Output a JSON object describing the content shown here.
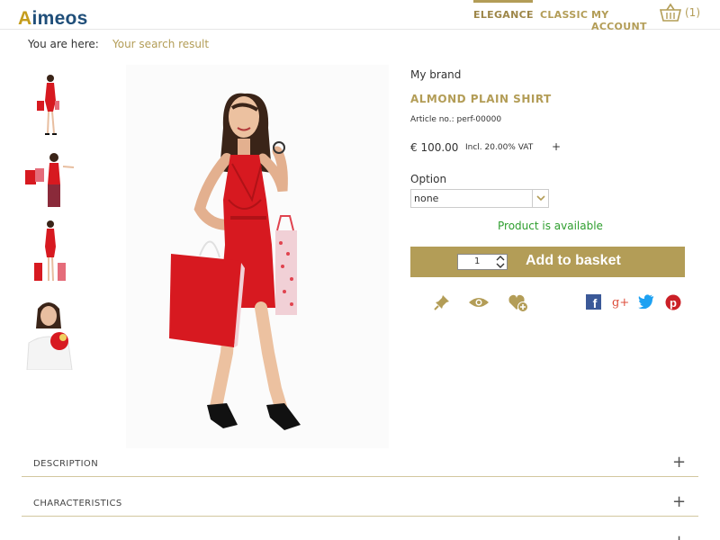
{
  "logo": {
    "first": "A",
    "rest": "imeos"
  },
  "nav": {
    "elegance": "ELEGANCE",
    "classic": "CLASSIC",
    "my_account": "MY ACCOUNT"
  },
  "basket": {
    "icon": "basket-icon",
    "count": "(1)"
  },
  "breadcrumb": {
    "label": "You are here:",
    "current": "Your search result"
  },
  "product": {
    "brand": "My brand",
    "title": "ALMOND PLAIN SHIRT",
    "article": "Article no.: perf-00000",
    "price": "€ 100.00",
    "vat": "Incl. 20.00% VAT",
    "price_more": "+",
    "option_label": "Option",
    "option_value": "none",
    "availability": "Product is available",
    "quantity": "1",
    "add_button": "Add to basket"
  },
  "actions": [
    {
      "name": "pin-icon"
    },
    {
      "name": "eye-icon"
    },
    {
      "name": "heart-plus-icon"
    }
  ],
  "share": [
    {
      "name": "facebook-icon",
      "label": "f"
    },
    {
      "name": "google-plus-icon",
      "label": "g+"
    },
    {
      "name": "twitter-icon"
    },
    {
      "name": "pinterest-icon",
      "label": "p"
    }
  ],
  "accordion": [
    {
      "title": "DESCRIPTION",
      "toggle": "+"
    },
    {
      "title": "CHARACTERISTICS",
      "toggle": "+"
    },
    {
      "title": "",
      "toggle": "+"
    }
  ],
  "colors": {
    "accent": "#b39d57",
    "available": "#2e9e2e",
    "dress": "#d71920"
  }
}
